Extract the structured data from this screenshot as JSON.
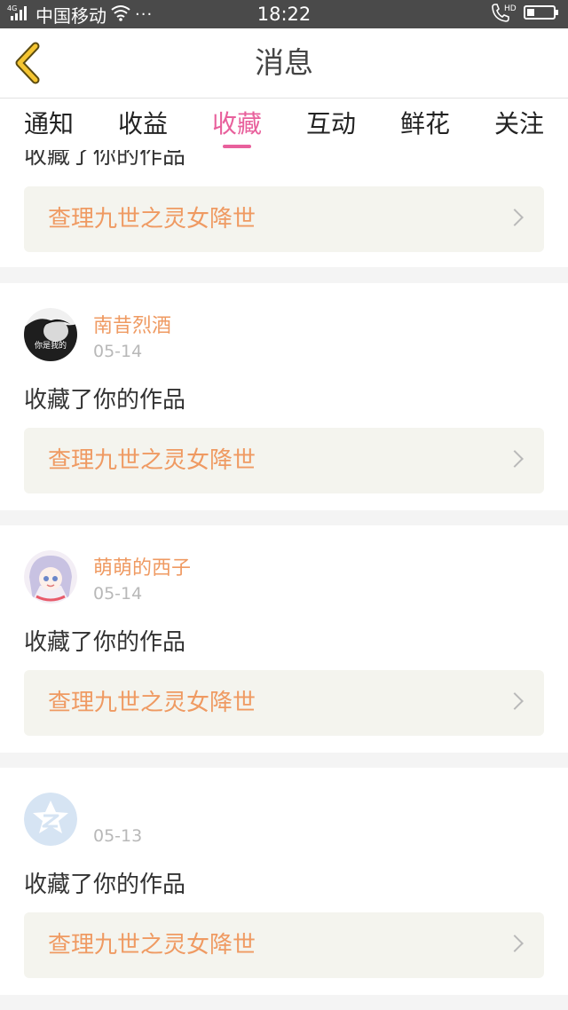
{
  "status_bar": {
    "network": "4G",
    "carrier": "中国移动",
    "dots": "···",
    "time": "18:22",
    "call_label": "HD"
  },
  "header": {
    "title": "消息"
  },
  "tabs": [
    {
      "label": "通知",
      "active": false
    },
    {
      "label": "收益",
      "active": false
    },
    {
      "label": "收藏",
      "active": true
    },
    {
      "label": "互动",
      "active": false
    },
    {
      "label": "鲜花",
      "active": false
    },
    {
      "label": "关注",
      "active": false
    }
  ],
  "messages": [
    {
      "user": "",
      "date": "",
      "text": "收藏了你的作品",
      "work": "查理九世之灵女降世"
    },
    {
      "user": "南昔烈酒",
      "date": "05-14",
      "text": "收藏了你的作品",
      "work": "查理九世之灵女降世",
      "avatar_caption": "你是我的"
    },
    {
      "user": "萌萌的西子",
      "date": "05-14",
      "text": "收藏了你的作品",
      "work": "查理九世之灵女降世"
    },
    {
      "user": "",
      "date": "05-13",
      "text": "收藏了你的作品",
      "work": "查理九世之灵女降世"
    }
  ],
  "colors": {
    "accent": "#e8609c",
    "name": "#ef9a62",
    "link_bg": "#f4f4ee",
    "back_icon": "#f5c531"
  },
  "icons": {
    "back": "chevron-left-icon",
    "row_arrow": "chevron-right-icon",
    "signal": "signal-icon",
    "wifi": "wifi-icon",
    "phone": "phone-icon",
    "battery": "battery-icon"
  }
}
